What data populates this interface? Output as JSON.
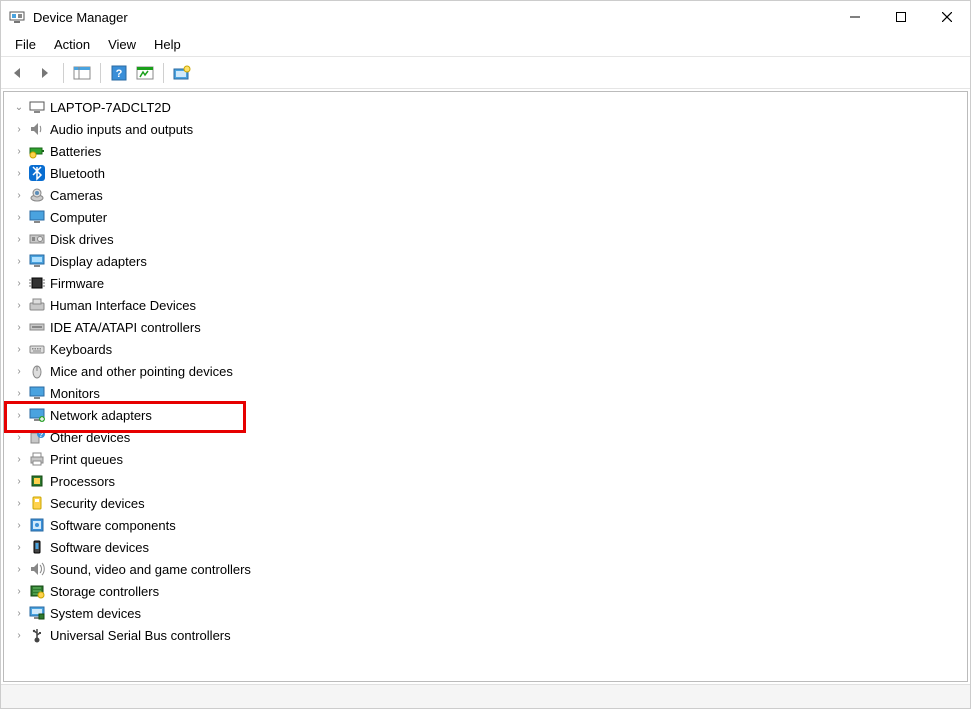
{
  "window": {
    "title": "Device Manager"
  },
  "menu": {
    "items": [
      "File",
      "Action",
      "View",
      "Help"
    ]
  },
  "tree": {
    "root": "LAPTOP-7ADCLT2D",
    "categories": [
      {
        "label": "Audio inputs and outputs",
        "icon": "speaker"
      },
      {
        "label": "Batteries",
        "icon": "battery"
      },
      {
        "label": "Bluetooth",
        "icon": "bluetooth"
      },
      {
        "label": "Cameras",
        "icon": "camera"
      },
      {
        "label": "Computer",
        "icon": "monitor"
      },
      {
        "label": "Disk drives",
        "icon": "disk"
      },
      {
        "label": "Display adapters",
        "icon": "display"
      },
      {
        "label": "Firmware",
        "icon": "chip"
      },
      {
        "label": "Human Interface Devices",
        "icon": "hid"
      },
      {
        "label": "IDE ATA/ATAPI controllers",
        "icon": "ide"
      },
      {
        "label": "Keyboards",
        "icon": "keyboard"
      },
      {
        "label": "Mice and other pointing devices",
        "icon": "mouse"
      },
      {
        "label": "Monitors",
        "icon": "monitor2"
      },
      {
        "label": "Network adapters",
        "icon": "network",
        "highlight": true
      },
      {
        "label": "Other devices",
        "icon": "other"
      },
      {
        "label": "Print queues",
        "icon": "printer"
      },
      {
        "label": "Processors",
        "icon": "cpu"
      },
      {
        "label": "Security devices",
        "icon": "security"
      },
      {
        "label": "Software components",
        "icon": "software"
      },
      {
        "label": "Software devices",
        "icon": "softdev"
      },
      {
        "label": "Sound, video and game controllers",
        "icon": "sound"
      },
      {
        "label": "Storage controllers",
        "icon": "storage"
      },
      {
        "label": "System devices",
        "icon": "system"
      },
      {
        "label": "Universal Serial Bus controllers",
        "icon": "usb"
      }
    ]
  }
}
